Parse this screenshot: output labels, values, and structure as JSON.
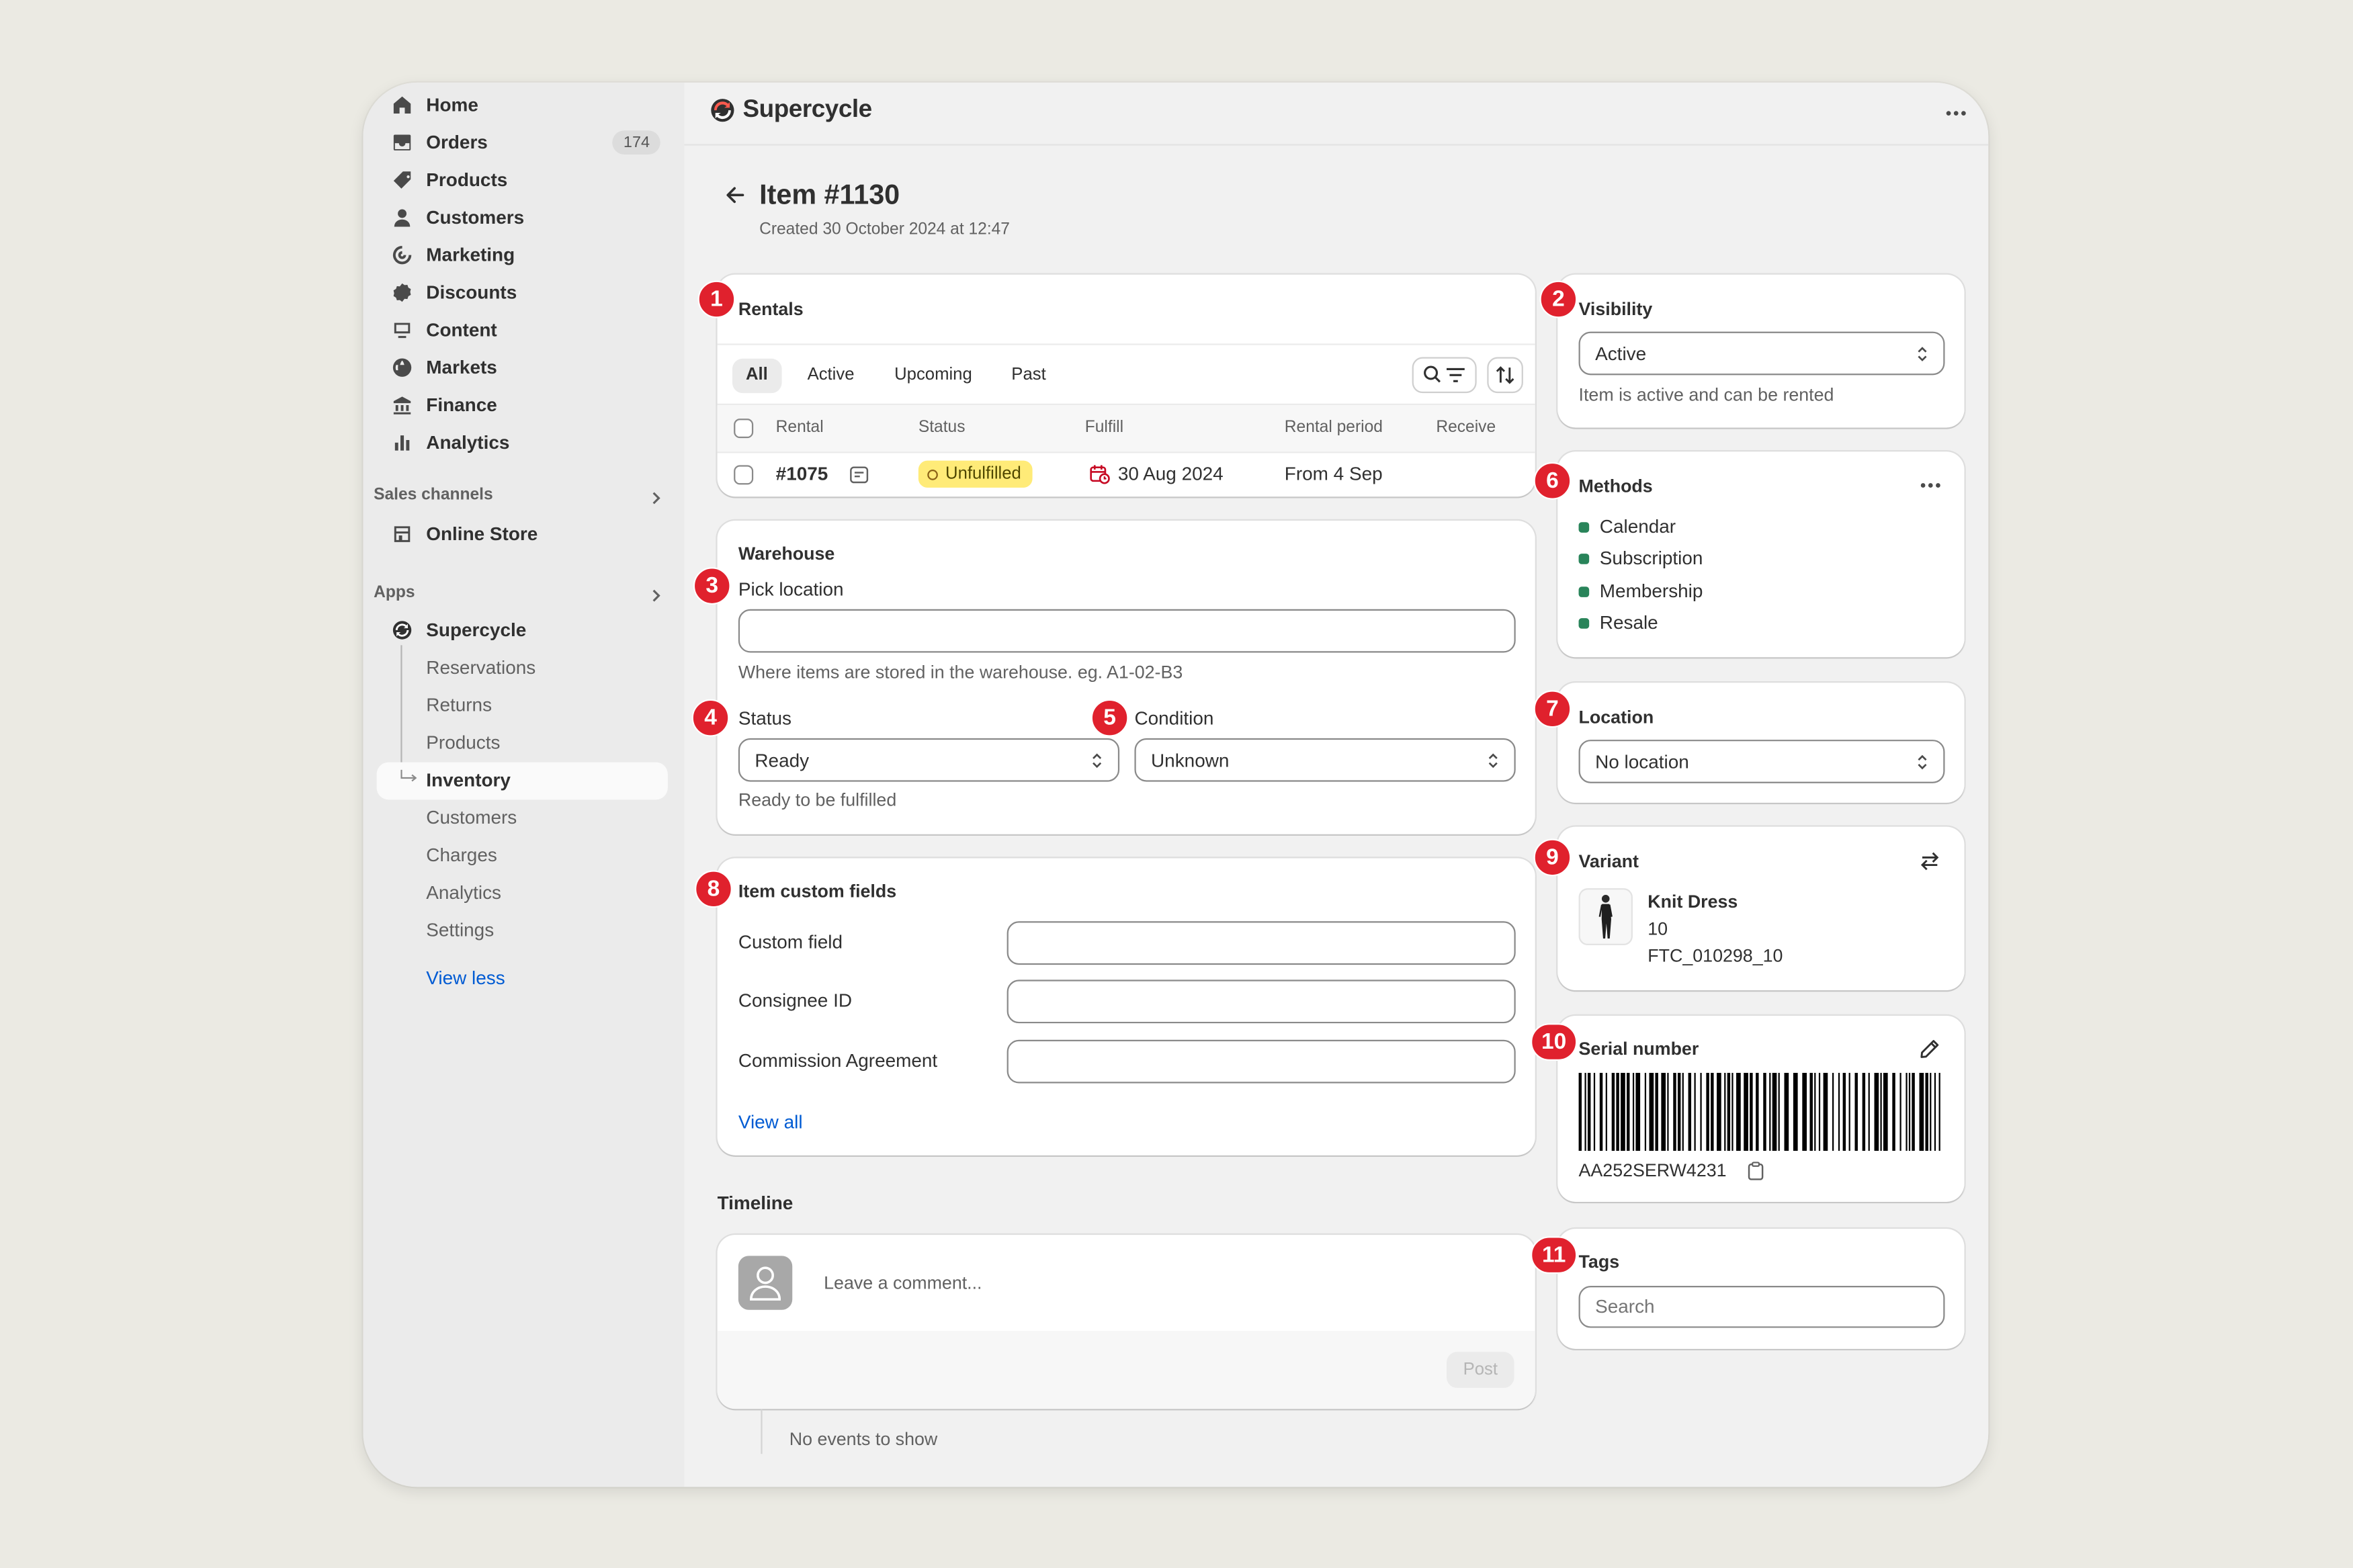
{
  "sidebar": {
    "nav": [
      {
        "label": "Home",
        "icon": "home-icon"
      },
      {
        "label": "Orders",
        "icon": "orders-icon",
        "badge": "174"
      },
      {
        "label": "Products",
        "icon": "tag-icon"
      },
      {
        "label": "Customers",
        "icon": "person-icon"
      },
      {
        "label": "Marketing",
        "icon": "target-icon"
      },
      {
        "label": "Discounts",
        "icon": "discount-icon"
      },
      {
        "label": "Content",
        "icon": "content-icon"
      },
      {
        "label": "Markets",
        "icon": "globe-icon"
      },
      {
        "label": "Finance",
        "icon": "bank-icon"
      },
      {
        "label": "Analytics",
        "icon": "bar-chart-icon"
      }
    ],
    "sales_channels_label": "Sales channels",
    "online_store": "Online Store",
    "apps_label": "Apps",
    "app_name": "Supercycle",
    "app_items": [
      "Reservations",
      "Returns",
      "Products",
      "Inventory",
      "Customers",
      "Charges",
      "Analytics",
      "Settings"
    ],
    "view_less": "View less"
  },
  "topbar": {
    "brand": "Supercycle"
  },
  "page": {
    "title": "Item #1130",
    "subtitle": "Created 30 October 2024 at 12:47"
  },
  "markers": [
    "1",
    "2",
    "3",
    "4",
    "5",
    "6",
    "7",
    "8",
    "9",
    "10",
    "11"
  ],
  "rentals": {
    "title": "Rentals",
    "tabs": [
      "All",
      "Active",
      "Upcoming",
      "Past"
    ],
    "columns": [
      "Rental",
      "Status",
      "Fulfill",
      "Rental period",
      "Receive"
    ],
    "rows": [
      {
        "rental": "#1075",
        "status": "Unfulfilled",
        "fulfill": "30 Aug 2024",
        "period": "From 4 Sep",
        "receive": ""
      }
    ]
  },
  "warehouse": {
    "title": "Warehouse",
    "pick_label": "Pick location",
    "pick_value": "",
    "pick_help": "Where items are stored in the warehouse. eg. A1-02-B3",
    "status_label": "Status",
    "status_value": "Ready",
    "status_help": "Ready to be fulfilled",
    "condition_label": "Condition",
    "condition_value": "Unknown"
  },
  "custom_fields": {
    "title": "Item custom fields",
    "fields": [
      {
        "label": "Custom field",
        "value": ""
      },
      {
        "label": "Consignee ID",
        "value": ""
      },
      {
        "label": "Commission Agreement",
        "value": ""
      }
    ],
    "view_all": "View all"
  },
  "timeline": {
    "title": "Timeline",
    "comment_placeholder": "Leave a comment...",
    "post_label": "Post",
    "empty": "No events to show"
  },
  "visibility": {
    "title": "Visibility",
    "value": "Active",
    "help": "Item is active and can be rented"
  },
  "methods": {
    "title": "Methods",
    "items": [
      "Calendar",
      "Subscription",
      "Membership",
      "Resale"
    ],
    "bullet_color": "#29845a"
  },
  "location": {
    "title": "Location",
    "value": "No location"
  },
  "variant": {
    "title": "Variant",
    "name": "Knit Dress",
    "size": "10",
    "sku": "FTC_010298_10"
  },
  "serial": {
    "title": "Serial number",
    "value": "AA252SERW4231"
  },
  "tags": {
    "title": "Tags",
    "placeholder": "Search"
  },
  "colors": {
    "marker": "#e0212d",
    "link": "#005bd3",
    "badge_warning": "#ffeb78"
  }
}
